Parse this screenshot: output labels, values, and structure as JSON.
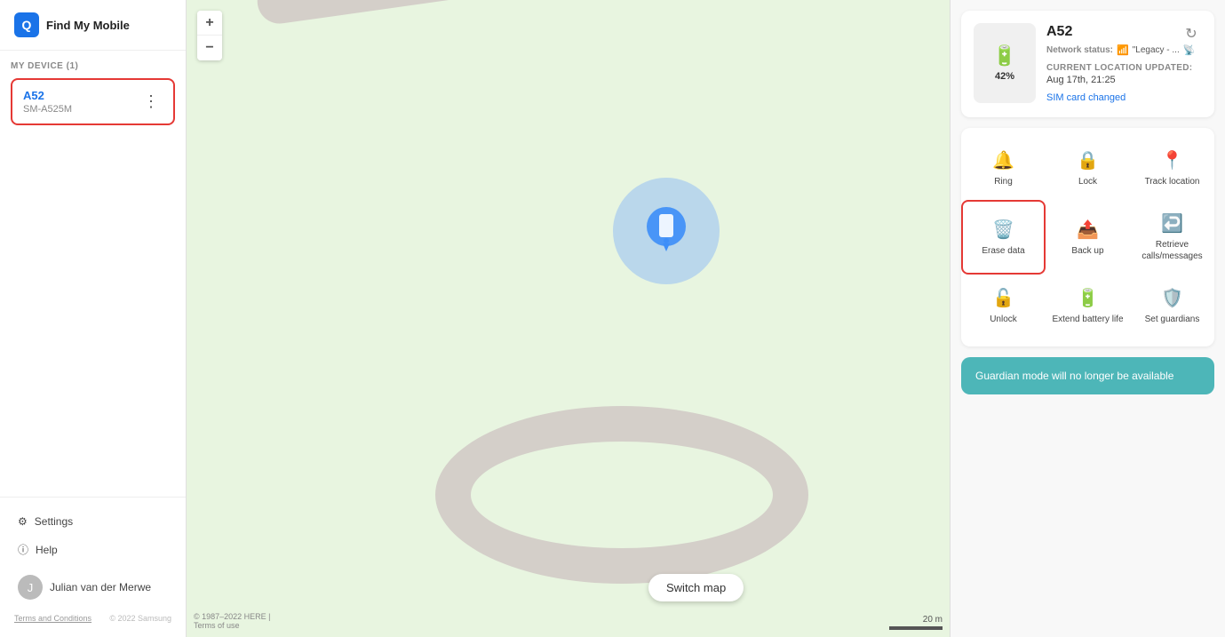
{
  "app": {
    "title": "Find My Mobile"
  },
  "sidebar": {
    "logo_letter": "Q",
    "device_section_label": "MY DEVICE (1)",
    "device_name": "A52",
    "device_model": "SM-A525M",
    "settings_label": "Settings",
    "help_label": "Help",
    "user_name": "Julian van der Merwe",
    "footer_links": "Terms and Conditions",
    "footer_copyright": "© 2022 Samsung"
  },
  "map": {
    "zoom_plus": "+",
    "zoom_minus": "−",
    "switch_map_label": "Switch map",
    "attribution": "© 1987–2022 HERE |\nTerms of use",
    "scale_label": "20 m"
  },
  "right_panel": {
    "device_name": "A52",
    "battery_percent": "42%",
    "network_status_label": "Network status:",
    "network_value": "\"Legacy - ...",
    "location_updated_label": "CURRENT LOCATION UPDATED:",
    "location_time": "Aug 17th, 21:25",
    "sim_changed": "SIM card changed",
    "actions": [
      {
        "id": "ring",
        "icon": "🔔",
        "label": "Ring"
      },
      {
        "id": "lock",
        "icon": "🔒",
        "label": "Lock"
      },
      {
        "id": "track-location",
        "icon": "📍",
        "label": "Track location"
      },
      {
        "id": "erase-data",
        "icon": "🗑",
        "label": "Erase data",
        "highlighted": true
      },
      {
        "id": "back-up",
        "icon": "📤",
        "label": "Back up"
      },
      {
        "id": "retrieve",
        "icon": "↩",
        "label": "Retrieve calls/messages"
      },
      {
        "id": "unlock",
        "icon": "🔓",
        "label": "Unlock"
      },
      {
        "id": "extend-battery",
        "icon": "🔋",
        "label": "Extend battery life"
      },
      {
        "id": "set-guardians",
        "icon": "🛡",
        "label": "Set guardians"
      }
    ],
    "guardian_banner": "Guardian mode will no longer be available"
  },
  "icons": {
    "settings": "⚙",
    "help": "ⓘ",
    "menu_dots": "⋮",
    "refresh": "↻",
    "wifi": "📶",
    "phone": "📱"
  }
}
